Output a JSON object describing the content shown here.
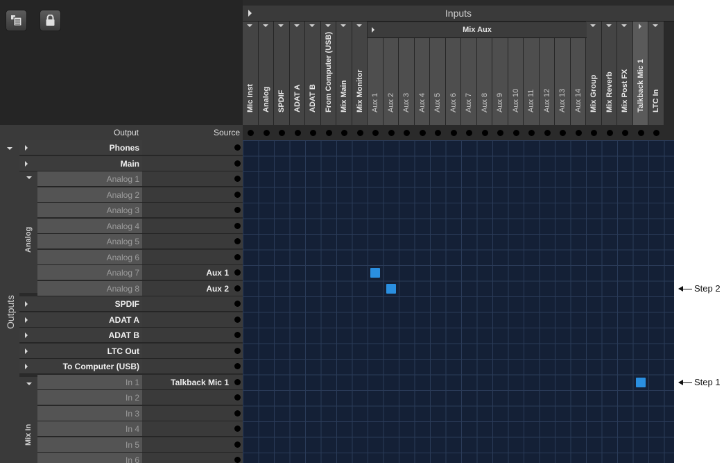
{
  "inputs_title": "Inputs",
  "mix_aux_label": "Mix Aux",
  "columns": [
    "Mic Inst",
    "Analog",
    "SPDIF",
    "ADAT A",
    "ADAT B",
    "From Computer (USB)",
    "Mix Main",
    "Mix Monitor",
    "Aux 1",
    "Aux 2",
    "Aux 3",
    "Aux 4",
    "Aux 5",
    "Aux 6",
    "Aux 7",
    "Aux 8",
    "Aux 9",
    "Aux 10",
    "Aux 11",
    "Aux 12",
    "Aux 13",
    "Aux 14",
    "Mix Group",
    "Mix Reverb",
    "Mix Post FX",
    "Talkback Mic 1",
    "LTC In"
  ],
  "header": {
    "output": "Output",
    "source": "Source"
  },
  "outputs_label": "Outputs",
  "analog_group_label": "Analog",
  "mixin_group_label": "Mix In",
  "rows": [
    {
      "label": "Phones",
      "type": "group",
      "source": ""
    },
    {
      "label": "Main",
      "type": "group",
      "source": ""
    },
    {
      "label": "Analog 1",
      "type": "sub",
      "source": ""
    },
    {
      "label": "Analog 2",
      "type": "sub",
      "source": ""
    },
    {
      "label": "Analog 3",
      "type": "sub",
      "source": ""
    },
    {
      "label": "Analog 4",
      "type": "sub",
      "source": ""
    },
    {
      "label": "Analog 5",
      "type": "sub",
      "source": ""
    },
    {
      "label": "Analog 6",
      "type": "sub",
      "source": ""
    },
    {
      "label": "Analog 7",
      "type": "sub",
      "source": "Aux 1"
    },
    {
      "label": "Analog 8",
      "type": "sub",
      "source": "Aux 2"
    },
    {
      "label": "SPDIF",
      "type": "group",
      "source": ""
    },
    {
      "label": "ADAT A",
      "type": "group",
      "source": ""
    },
    {
      "label": "ADAT B",
      "type": "group",
      "source": ""
    },
    {
      "label": "LTC Out",
      "type": "group",
      "source": ""
    },
    {
      "label": "To Computer (USB)",
      "type": "group",
      "source": ""
    },
    {
      "label": "In 1",
      "type": "sub",
      "source": "Talkback Mic 1"
    },
    {
      "label": "In 2",
      "type": "sub",
      "source": ""
    },
    {
      "label": "In 3",
      "type": "sub",
      "source": ""
    },
    {
      "label": "In 4",
      "type": "sub",
      "source": ""
    },
    {
      "label": "In 5",
      "type": "sub",
      "source": ""
    },
    {
      "label": "In 6",
      "type": "sub",
      "source": ""
    }
  ],
  "connections": [
    {
      "output": "Analog 7",
      "input": "Aux 1"
    },
    {
      "output": "Analog 8",
      "input": "Aux 2"
    },
    {
      "output": "In 1",
      "input": "Talkback Mic 1"
    }
  ],
  "annotations": [
    {
      "label": "Step 2",
      "row": "Analog 8"
    },
    {
      "label": "Step 1",
      "row": "In 1"
    }
  ],
  "colors": {
    "active_cell": "#2a8fe0",
    "grid_bg": "#142036"
  }
}
